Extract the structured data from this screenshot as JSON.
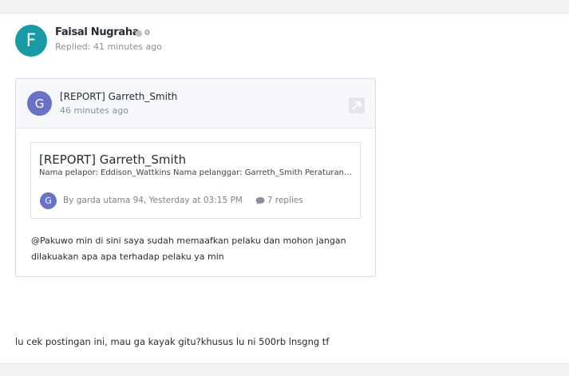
{
  "post": {
    "author": {
      "initial": "F",
      "name": "Faisal Nugraha",
      "reputation": "0",
      "replied": "Replied: 41 minutes ago",
      "avatar_color": "#1a9aa5"
    },
    "embed": {
      "avatar_initial": "G",
      "avatar_color": "#6a72c4",
      "title": "[REPORT] Garreth_Smith",
      "time": "46 minutes ago",
      "open_icon": "external-link-icon",
      "quote": {
        "title": "[REPORT] Garreth_Smith",
        "snippet": "Nama pelapor: Eddison_Wattkins Nama pelanggar: Garreth_Smith Peraturan yang dilanggar",
        "avatar_initial": "G",
        "meta": "By garda utama 94, Yesterday at 03:15 PM",
        "replies": "7 replies",
        "replies_icon": "comment-bubble-icon"
      },
      "text": "@Pakuwo min di sini saya sudah memaafkan pelaku dan mohon jangan dilakuakan apa apa terhadap pelaku  ya min"
    },
    "comment": "lu cek postingan ini, mau ga kayak gitu?khusus lu ni 500rb lnsgng tf"
  }
}
